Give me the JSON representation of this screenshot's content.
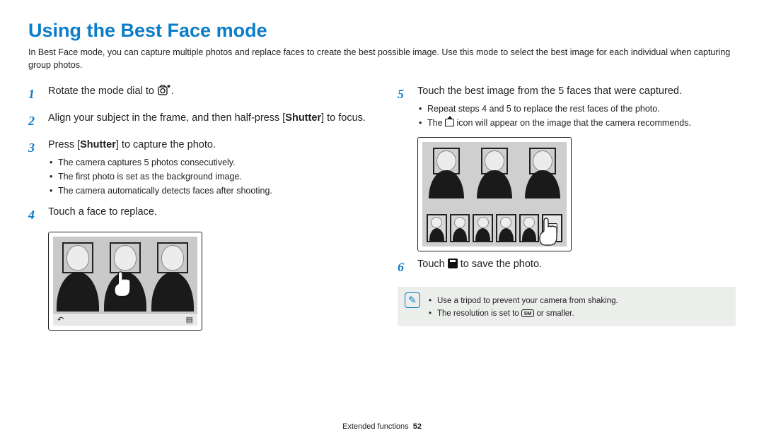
{
  "title": "Using the Best Face mode",
  "intro": "In Best Face mode, you can capture multiple photos and replace faces to create the best possible image. Use this mode to select the best image for each individual when capturing group photos.",
  "steps": {
    "s1": {
      "num": "1",
      "text_pre": "Rotate the mode dial to ",
      "text_post": "."
    },
    "s2": {
      "num": "2",
      "text_a": "Align your subject in the frame, and then half-press [",
      "bold": "Shutter",
      "text_b": "] to focus."
    },
    "s3": {
      "num": "3",
      "text_a": "Press [",
      "bold": "Shutter",
      "text_b": "] to capture the photo.",
      "bullets": [
        "The camera captures 5 photos consecutively.",
        "The first photo is set as the background image.",
        "The camera automatically detects faces after shooting."
      ]
    },
    "s4": {
      "num": "4",
      "text": "Touch a face to replace."
    },
    "s5": {
      "num": "5",
      "text": "Touch the best image from the 5 faces that were captured.",
      "bullets": {
        "b1": "Repeat steps 4 and 5 to replace the rest faces of the photo.",
        "b2_a": "The ",
        "b2_b": " icon will appear on the image that the camera recommends."
      }
    },
    "s6": {
      "num": "6",
      "text_a": "Touch ",
      "text_b": " to save the photo."
    }
  },
  "note": {
    "b1": "Use a tripod to prevent your camera from shaking.",
    "b2_a": "The resolution is set to ",
    "res_label": "5M",
    "b2_b": " or smaller."
  },
  "footer": {
    "section": "Extended functions",
    "page": "52"
  }
}
